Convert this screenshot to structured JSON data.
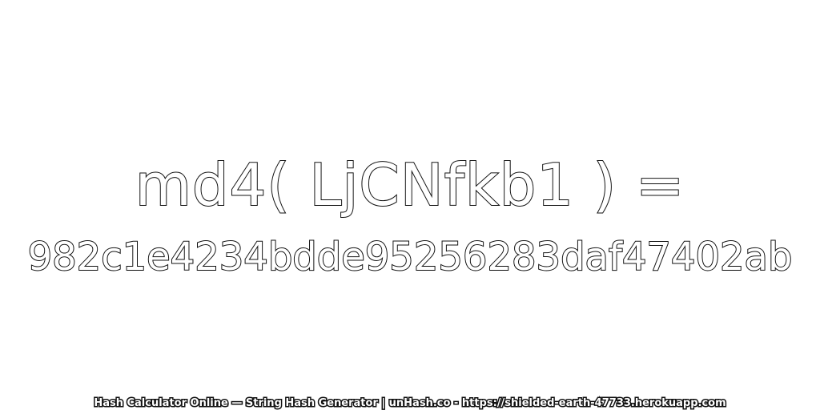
{
  "expression": "md4( LjCNfkb1 ) =",
  "digest": "982c1e4234bdde95256283daf47402ab",
  "footer": "Hash Calculator Online — String Hash Generator | unHash.co - https://shielded-earth-47733.herokuapp.com",
  "colors": {
    "background": "#ffffff",
    "text_fill": "#ffffff",
    "text_outline": "#111111"
  }
}
